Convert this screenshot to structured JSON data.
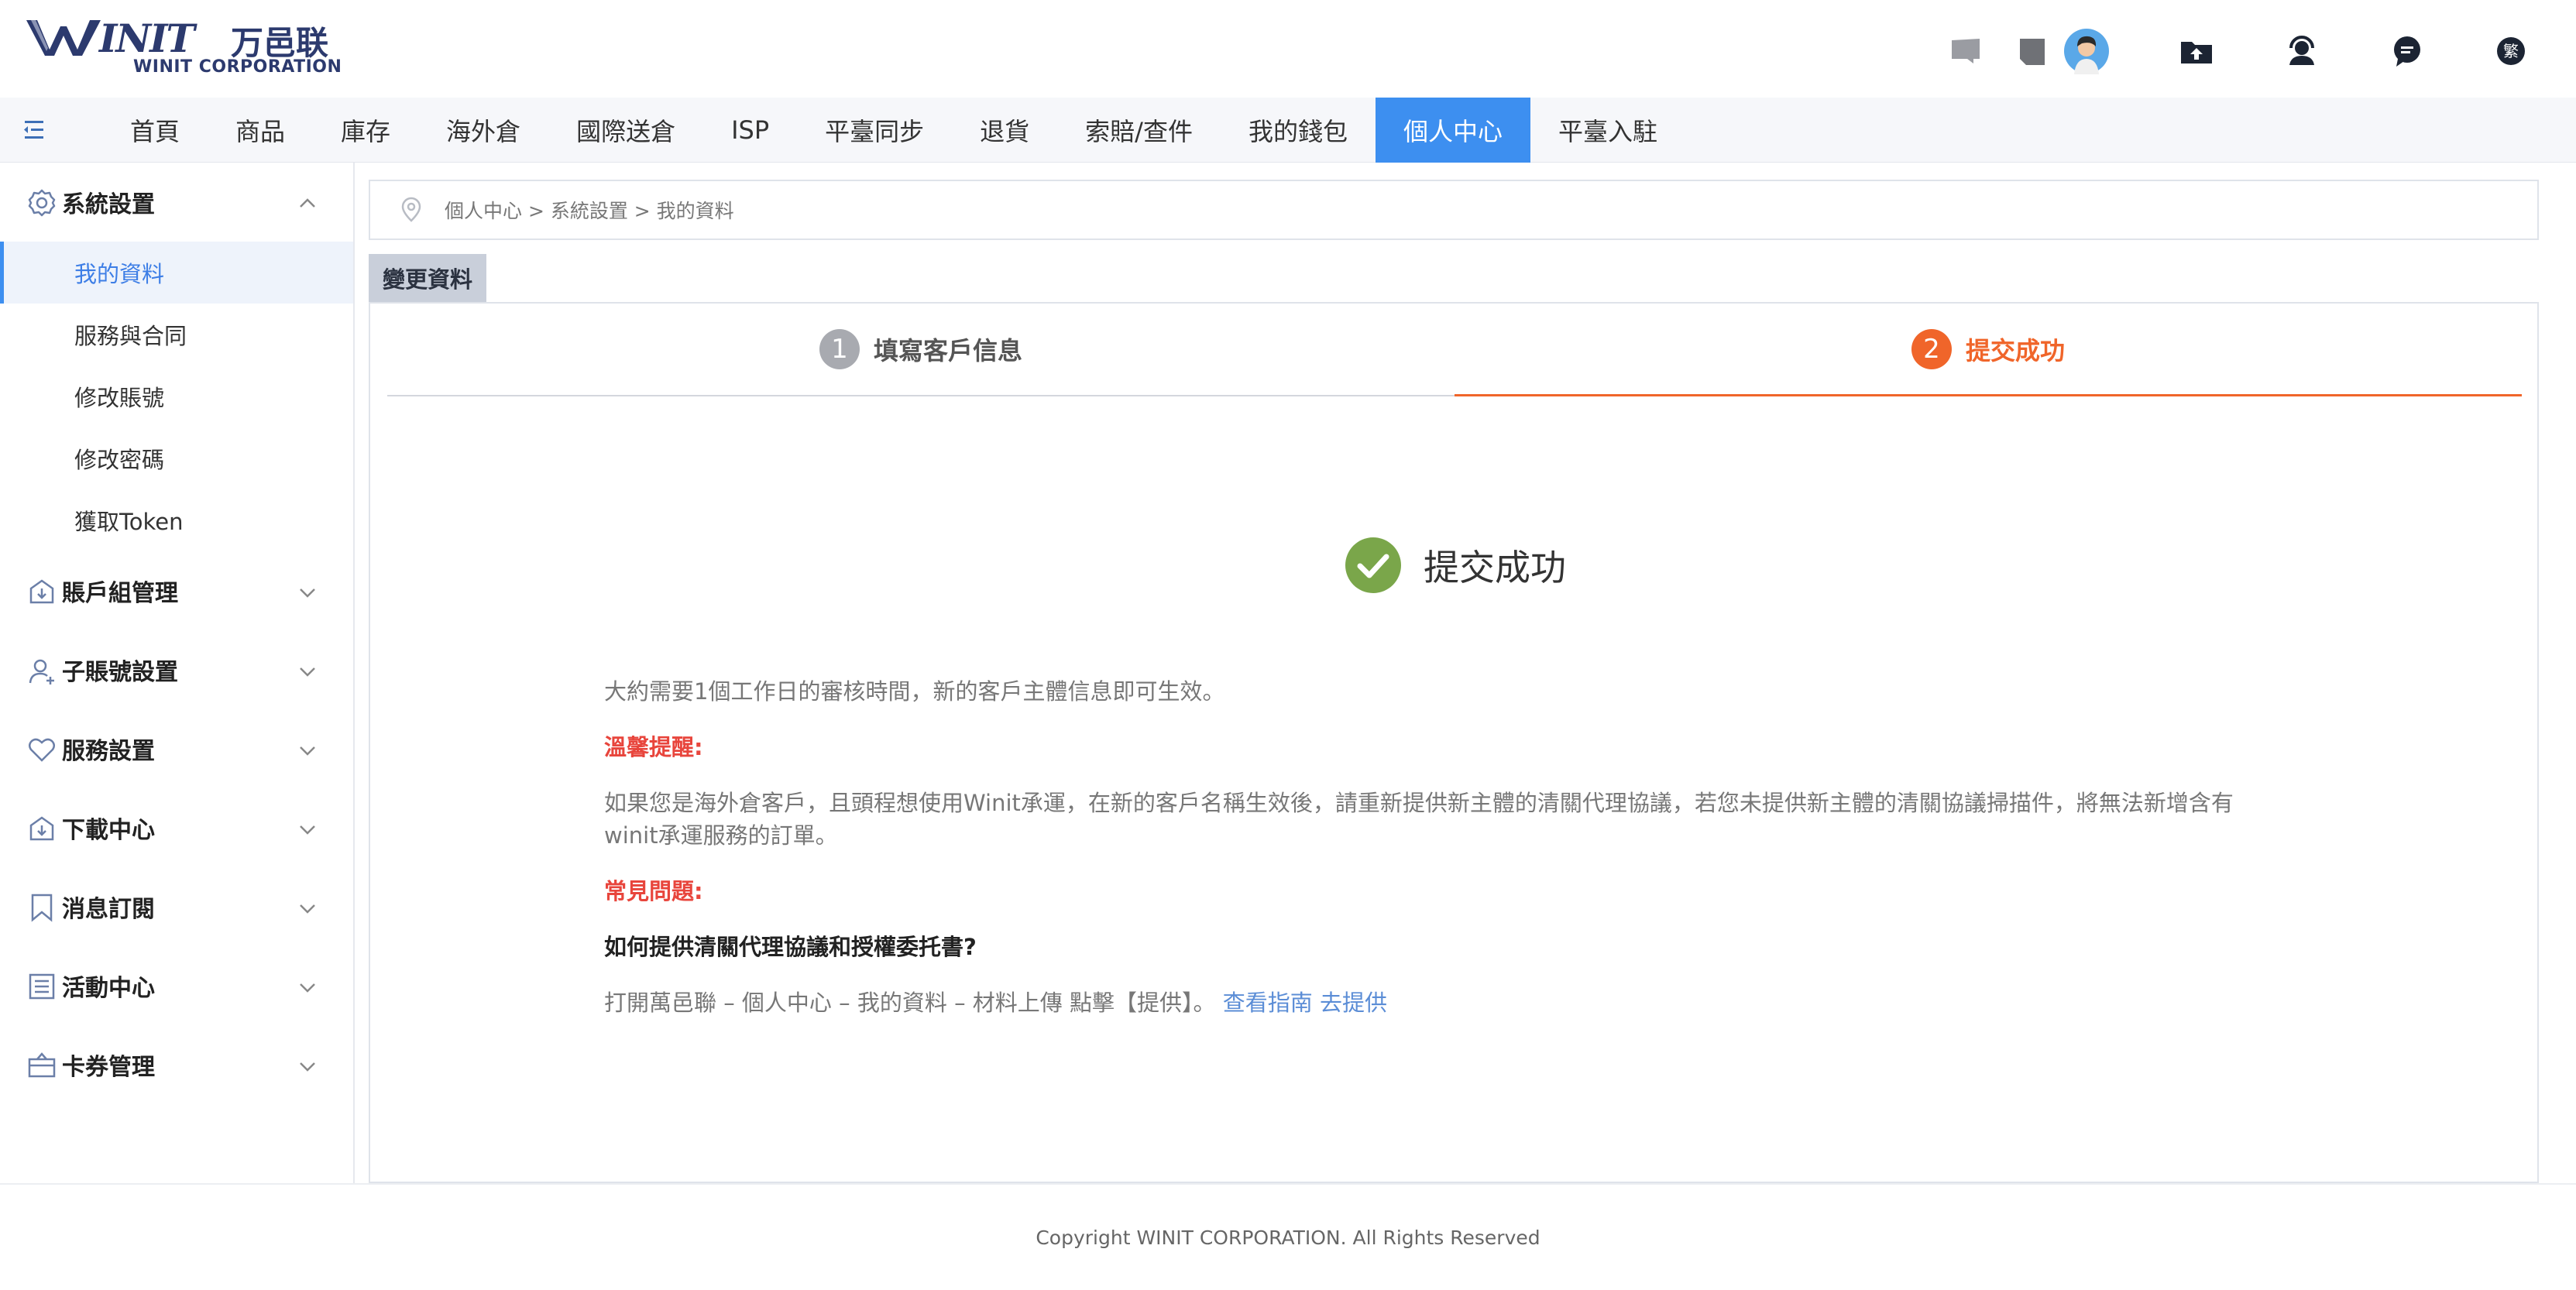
{
  "header": {
    "logo_mark": "INIT",
    "logo_cn": "万邑联",
    "logo_sub": "WINIT CORPORATION",
    "icons": [
      "chat-bubble-icon",
      "note-icon",
      "avatar",
      "upload-folder-icon",
      "support-agent-icon",
      "message-icon",
      "language-icon"
    ],
    "language_label": "繁"
  },
  "nav": {
    "items": [
      {
        "label": "首頁"
      },
      {
        "label": "商品"
      },
      {
        "label": "庫存"
      },
      {
        "label": "海外倉"
      },
      {
        "label": "國際送倉"
      },
      {
        "label": "ISP"
      },
      {
        "label": "平臺同步"
      },
      {
        "label": "退貨"
      },
      {
        "label": "索賠/查件"
      },
      {
        "label": "我的錢包"
      },
      {
        "label": "個人中心",
        "active": true
      },
      {
        "label": "平臺入駐"
      }
    ]
  },
  "sidebar": {
    "system_settings": {
      "label": "系統設置",
      "items": [
        "我的資料",
        "服務與合同",
        "修改賬號",
        "修改密碼",
        "獲取Token"
      ],
      "active": "我的資料"
    },
    "groups": [
      "賬戶組管理",
      "子賬號設置",
      "服務設置",
      "下載中心",
      "消息訂閱",
      "活動中心",
      "卡券管理"
    ]
  },
  "breadcrumb": "個人中心 > 系統設置 > 我的資料",
  "section_tab": "變更資料",
  "steps": [
    {
      "num": "1",
      "label": "填寫客戶信息"
    },
    {
      "num": "2",
      "label": "提交成功"
    }
  ],
  "success_title": "提交成功",
  "body": {
    "review_text": "大約需要1個工作日的審核時間，新的客戶主體信息即可生效。",
    "reminder_title": "溫馨提醒:",
    "reminder_line1": "如果您是海外倉客戶，且頭程想使用Winit承運，在新的客戶名稱生效後，請重新提供新主體的清關代理協議，若您未提供新主體的清關協議掃描件，將無法新增含有",
    "reminder_line2": "winit承運服務的訂單。",
    "faq_title": "常見問題:",
    "faq_question": "如何提供清關代理協議和授權委托書?",
    "faq_answer": "打開萬邑聯 – 個人中心 – 我的資料 – 材料上傳 點擊【提供】。",
    "link_guide": "查看指南",
    "link_provide": "去提供"
  },
  "footer": "Copyright WINIT CORPORATION. All Rights Reserved",
  "colors": {
    "primary": "#3d8ff0",
    "accent_orange": "#f0652a",
    "success_green": "#7aa64a",
    "warning_red": "#e8453c",
    "link_blue": "#5b8dd6"
  }
}
